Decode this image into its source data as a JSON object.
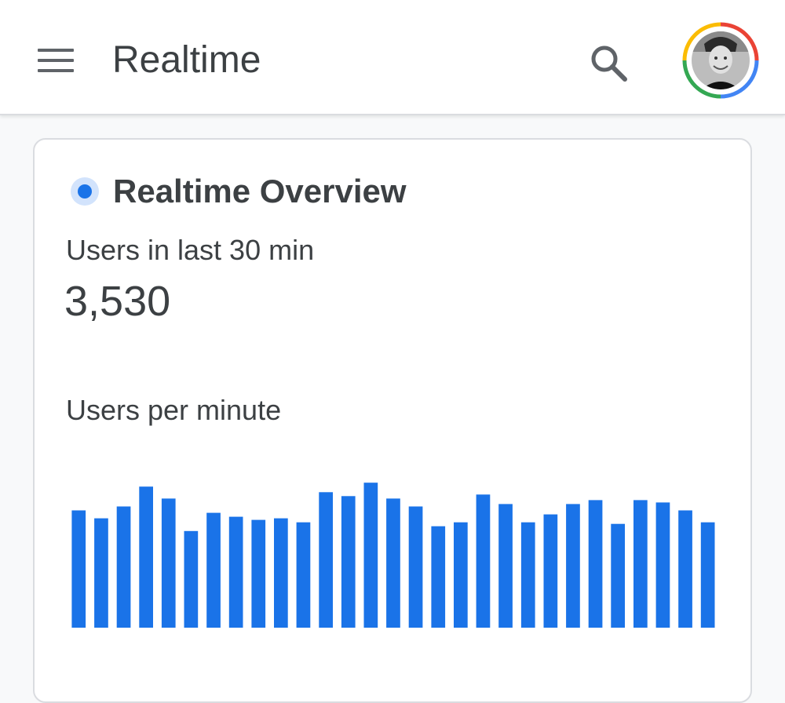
{
  "appbar": {
    "title": "Realtime",
    "menu_icon": "hamburger-menu-icon",
    "search_icon": "search-icon",
    "avatar": "account-avatar"
  },
  "card": {
    "title": "Realtime Overview",
    "live_indicator_icon": "live-dot-icon",
    "metric_label": "Users in last 30 min",
    "metric_value": "3,530",
    "chart_label": "Users per minute"
  },
  "colors": {
    "accent": "#1a73e8",
    "accent_light": "#d2e3fc",
    "text": "#3c4043",
    "icon": "#5f6368",
    "google_red": "#ea4335",
    "google_yellow": "#fbbc04",
    "google_green": "#34a853",
    "google_blue": "#4285f4"
  },
  "chart_data": {
    "type": "bar",
    "title": "Users per minute",
    "values": [
      148,
      138,
      153,
      178,
      163,
      122,
      145,
      140,
      136,
      138,
      133,
      171,
      166,
      183,
      163,
      153,
      128,
      133,
      168,
      156,
      133,
      143,
      156,
      161,
      131,
      161,
      158,
      148,
      133
    ],
    "color": "#1a73e8",
    "grid": false,
    "axes_visible": false
  }
}
